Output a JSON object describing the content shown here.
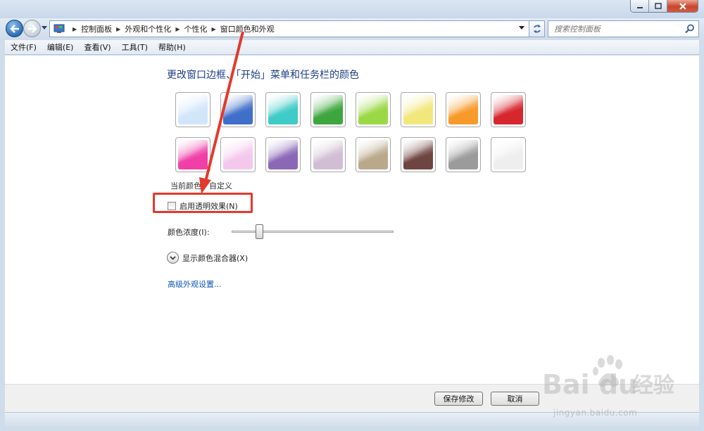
{
  "address": {
    "crumbs": [
      "控制面板",
      "外观和个性化",
      "个性化",
      "窗口颜色和外观"
    ],
    "search_placeholder": "搜索控制面板"
  },
  "menu": [
    "文件(F)",
    "编辑(E)",
    "查看(V)",
    "工具(T)",
    "帮助(H)"
  ],
  "main": {
    "heading": "更改窗口边框、「开始」菜单和任务栏的颜色",
    "swatches": [
      {
        "name": "sky",
        "color": "#d2e6fb"
      },
      {
        "name": "twilight",
        "color": "#3f6fc9"
      },
      {
        "name": "sea",
        "color": "#3fcbc8"
      },
      {
        "name": "leaf",
        "color": "#3ea63e"
      },
      {
        "name": "lime",
        "color": "#9bd845"
      },
      {
        "name": "sun",
        "color": "#f1e77a"
      },
      {
        "name": "pumpkin",
        "color": "#f89a2a"
      },
      {
        "name": "ruby",
        "color": "#d6262e"
      },
      {
        "name": "fuchsia",
        "color": "#f03fa7"
      },
      {
        "name": "blush",
        "color": "#f4c8ec"
      },
      {
        "name": "violet",
        "color": "#8b68b6"
      },
      {
        "name": "lavender",
        "color": "#d1bed4"
      },
      {
        "name": "taupe",
        "color": "#b9a98a"
      },
      {
        "name": "chocolate",
        "color": "#6e4540"
      },
      {
        "name": "slate",
        "color": "#9b9b9b"
      },
      {
        "name": "frost",
        "color": "#eeeeee"
      }
    ],
    "current_color_label": "当前颜色：自定义",
    "transparency_label": "启用透明效果(N)",
    "transparency_checked": false,
    "intensity_label": "颜色浓度(I):",
    "intensity_value": 0.17,
    "mixer_label": "显示颜色混合器(X)",
    "advanced_link": "高级外观设置..."
  },
  "footer": {
    "save_label": "保存修改",
    "cancel_label": "取消"
  },
  "watermark": {
    "text": "jingyan.baidu.com"
  },
  "colors": {
    "annotation": "#e23a2c",
    "link": "#0b56b8",
    "heading": "#1e3d87"
  }
}
